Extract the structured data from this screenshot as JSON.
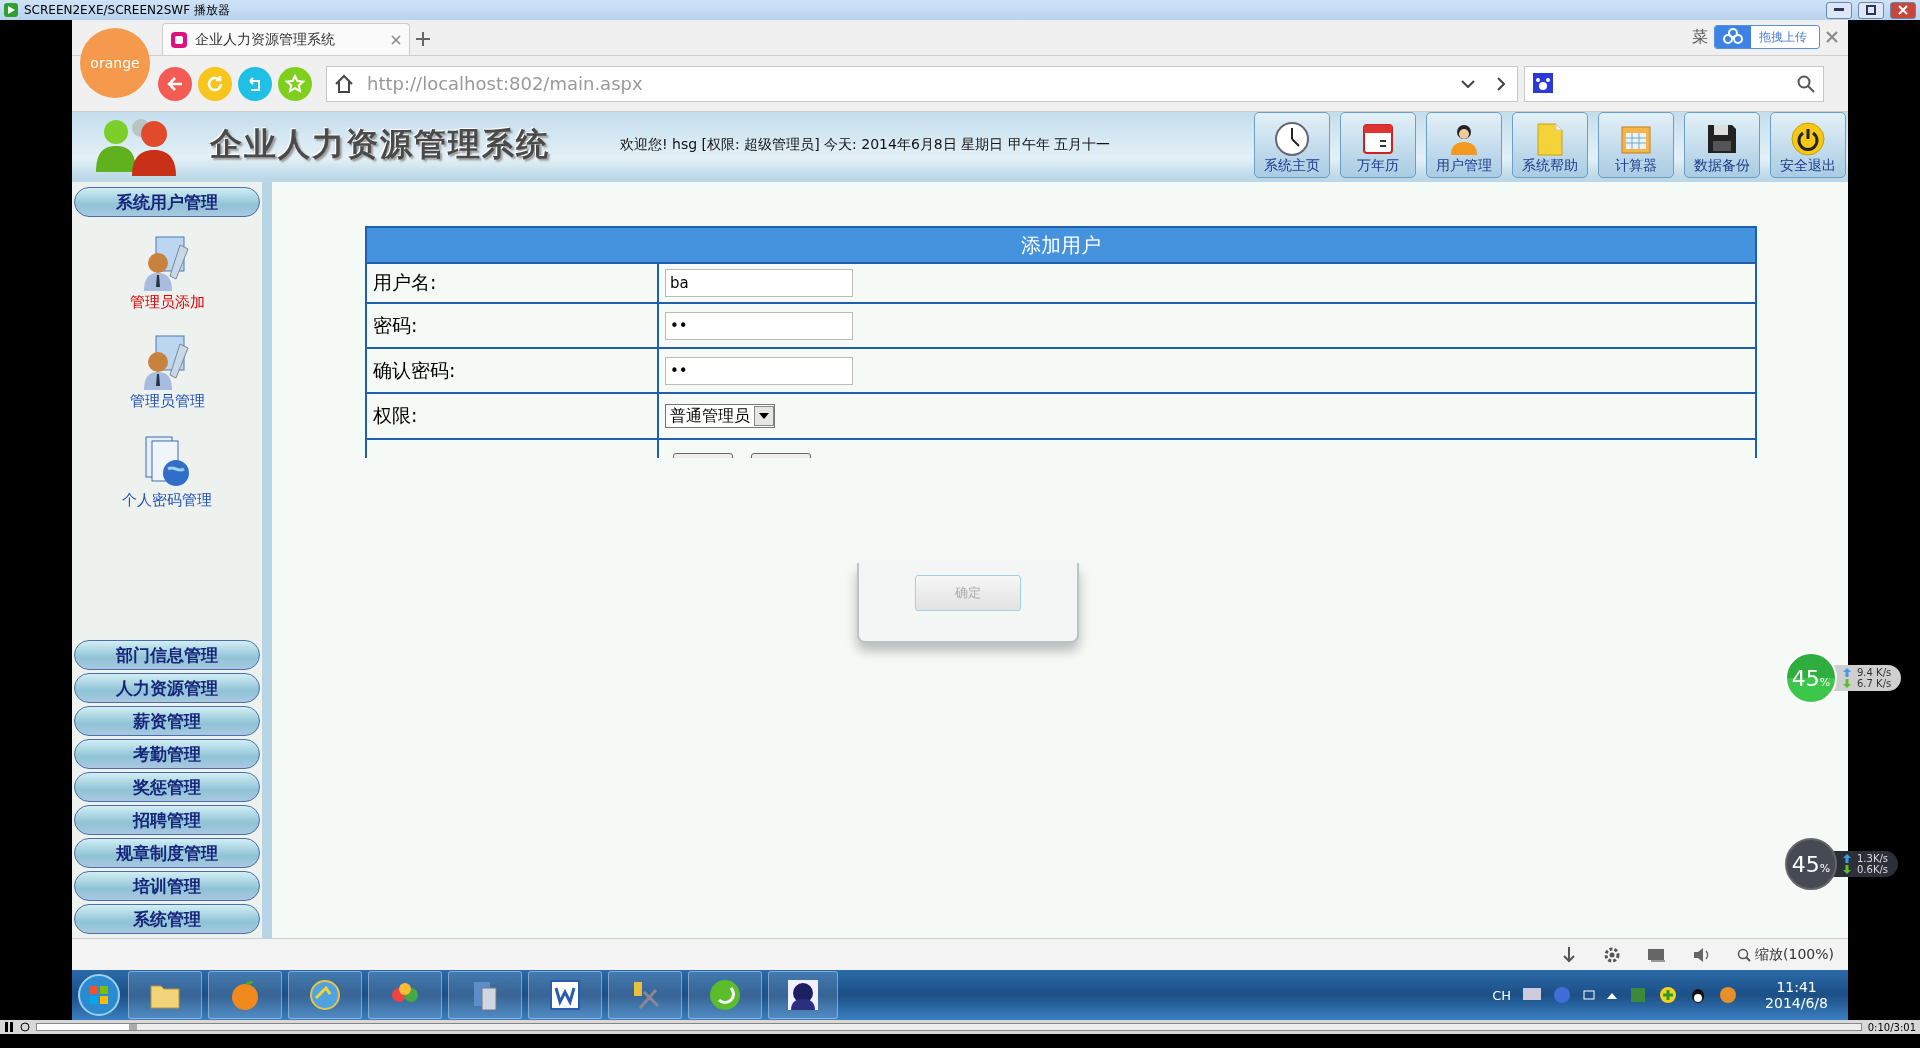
{
  "player": {
    "title": "SCREEN2EXE/SCREEN2SWF 播放器",
    "time": "0:10/3:01",
    "progress": {
      "level": 0.055
    }
  },
  "browser": {
    "logo": "orange",
    "tab": {
      "title": "企业人力资源管理系统",
      "selected": true
    },
    "tab_bar_partial": "菜",
    "upload_button": "拖拽上传",
    "address": "http://localhost:802/main.aspx",
    "zoom": "缩放(100%)"
  },
  "header": {
    "title": "企业人力资源管理系统",
    "welcome": "欢迎您! hsg [权限: 超级管理员] 今天:  2014年6月8日 星期日 甲午年 五月十一",
    "toolbar": [
      {
        "label": "系统主页",
        "kind": "clock"
      },
      {
        "label": "万年历",
        "kind": "calendar"
      },
      {
        "label": "用户管理",
        "kind": "person"
      },
      {
        "label": "系统帮助",
        "kind": "folder"
      },
      {
        "label": "计算器",
        "kind": "planner"
      },
      {
        "label": "数据备份",
        "kind": "disk"
      },
      {
        "label": "安全退出",
        "kind": "power"
      }
    ]
  },
  "sidebar": {
    "sections": [
      {
        "label": "系统用户管理",
        "items": [
          {
            "label": "管理员添加",
            "selected": true,
            "kind": "admin"
          },
          {
            "label": "管理员管理",
            "selected": false,
            "kind": "admin"
          },
          {
            "label": "个人密码管理",
            "selected": false,
            "kind": "documents"
          }
        ]
      },
      {
        "label": "部门信息管理"
      },
      {
        "label": "人力资源管理"
      },
      {
        "label": "薪资管理"
      },
      {
        "label": "考勤管理"
      },
      {
        "label": "奖惩管理"
      },
      {
        "label": "招聘管理"
      },
      {
        "label": "规章制度管理"
      },
      {
        "label": "培训管理"
      },
      {
        "label": "系统管理"
      }
    ]
  },
  "form": {
    "title": "添加用户",
    "fields": [
      {
        "label": "用户名:",
        "kind": "text",
        "value": "ba"
      },
      {
        "label": "密码:",
        "kind": "text",
        "value": "••"
      },
      {
        "label": "确认密码:",
        "kind": "text",
        "value": "••"
      },
      {
        "label": "权限:",
        "kind": "select",
        "value": "普通管理员"
      }
    ]
  },
  "dialog": {
    "button": "确定"
  },
  "widgets": [
    {
      "kind": "green",
      "percent": "45",
      "unit": "%",
      "up": "9.4 K/s",
      "down": "6.7 K/s"
    },
    {
      "kind": "dark",
      "percent": "45",
      "unit": "%",
      "up": "1.3K/s",
      "down": "0.6K/s"
    }
  ],
  "taskbar": {
    "apps": [
      {
        "kind": "folder"
      },
      {
        "kind": "orange"
      },
      {
        "kind": "globe"
      },
      {
        "kind": "pinwheel"
      },
      {
        "kind": "files"
      },
      {
        "kind": "word"
      },
      {
        "kind": "tools"
      },
      {
        "kind": "player"
      },
      {
        "kind": "avatar"
      }
    ],
    "language": "CH",
    "time": "11:41",
    "date": "2014/6/8"
  }
}
